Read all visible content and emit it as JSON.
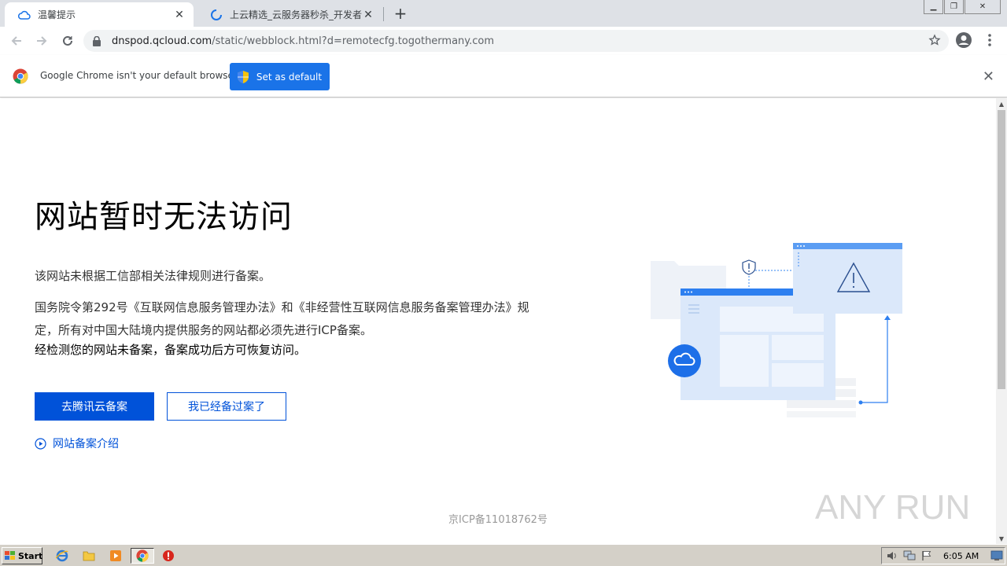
{
  "browser": {
    "tabs": [
      {
        "title": "温馨提示",
        "active": true
      },
      {
        "title": "上云精选_云服务器秒杀_开发者上云",
        "active": false
      }
    ],
    "url_host": "dnspod.qcloud.com",
    "url_path": "/static/webblock.html?d=remotecfg.togothermany.com"
  },
  "infobar": {
    "message": "Google Chrome isn't your default browser",
    "button_label": "Set as default"
  },
  "page": {
    "title": "网站暂时无法访问",
    "para1": "该网站未根据工信部相关法律规则进行备案。",
    "para2": "国务院令第292号《互联网信息服务管理办法》和《非经营性互联网信息服务备案管理办法》规定，所有对中国大陆境内提供服务的网站都必须先进行ICP备案。",
    "para3": "经检测您的网站未备案，备案成功后方可恢复访问。",
    "primary_button": "去腾讯云备案",
    "secondary_button": "我已经备过案了",
    "intro_link": "网站备案介绍",
    "footer": "京ICP备11018762号"
  },
  "watermark": "ANY RUN",
  "taskbar": {
    "start_label": "Start",
    "clock": "6:05 AM"
  },
  "colors": {
    "primary": "#0052d9",
    "chrome_blue": "#1a73e8",
    "illustration_light": "#dbe8fa"
  }
}
